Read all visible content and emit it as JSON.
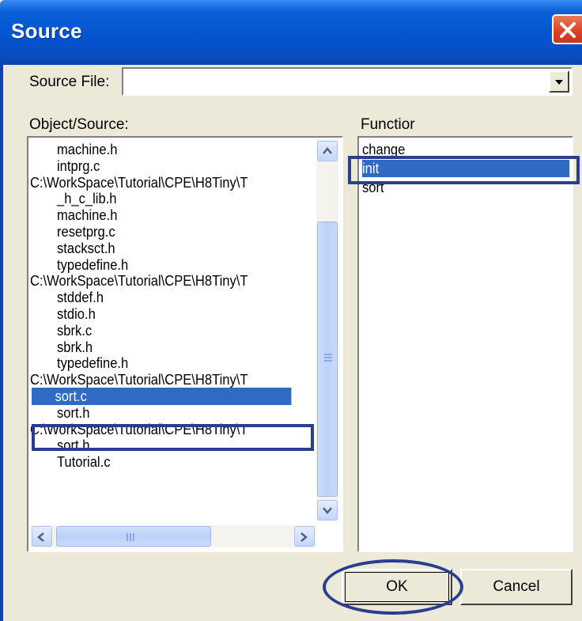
{
  "window": {
    "title": "Source"
  },
  "source_file": {
    "label": "Source File:",
    "value": ""
  },
  "object_list": {
    "label": "Object/Source:",
    "items": [
      {
        "text": "machine.h",
        "indent": true
      },
      {
        "text": "intprg.c",
        "indent": true
      },
      {
        "text": "C:\\WorkSpace\\Tutorial\\CPE\\H8Tiny\\T",
        "indent": false
      },
      {
        "text": "_h_c_lib.h",
        "indent": true
      },
      {
        "text": "machine.h",
        "indent": true
      },
      {
        "text": "resetprg.c",
        "indent": true
      },
      {
        "text": "stacksct.h",
        "indent": true
      },
      {
        "text": "typedefine.h",
        "indent": true
      },
      {
        "text": "C:\\WorkSpace\\Tutorial\\CPE\\H8Tiny\\T",
        "indent": false
      },
      {
        "text": "stddef.h",
        "indent": true
      },
      {
        "text": "stdio.h",
        "indent": true
      },
      {
        "text": "sbrk.c",
        "indent": true
      },
      {
        "text": "sbrk.h",
        "indent": true
      },
      {
        "text": "typedefine.h",
        "indent": true
      },
      {
        "text": "C:\\WorkSpace\\Tutorial\\CPE\\H8Tiny\\T",
        "indent": false
      },
      {
        "text": "sort.c",
        "indent": true,
        "selected": true
      },
      {
        "text": "sort.h",
        "indent": true
      },
      {
        "text": "C:\\WorkSpace\\Tutorial\\CPE\\H8Tiny\\T",
        "indent": false
      },
      {
        "text": "sort.h",
        "indent": true
      },
      {
        "text": "Tutorial.c",
        "indent": true
      }
    ]
  },
  "function_list": {
    "label": "Functior",
    "items": [
      {
        "text": "change"
      },
      {
        "text": "init",
        "selected": true
      },
      {
        "text": "sort"
      }
    ]
  },
  "buttons": {
    "ok": "OK",
    "cancel": "Cancel"
  },
  "colors": {
    "selection": "#316ac5",
    "annotation": "#2a3d8f",
    "titlebar": "#0553d0"
  }
}
